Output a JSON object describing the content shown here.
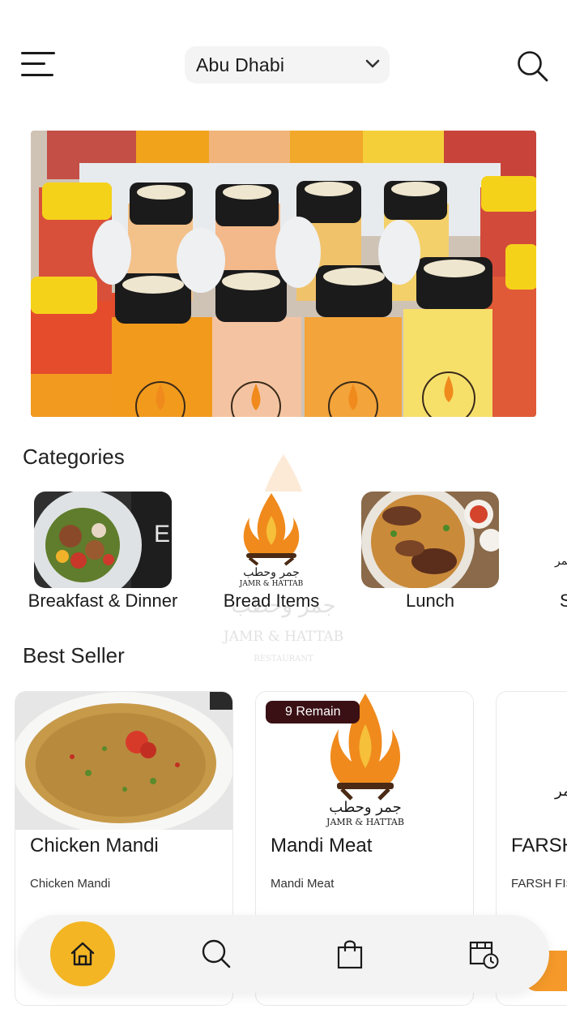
{
  "header": {
    "menu_icon": "hamburger-menu-icon",
    "location": "Abu Dhabi",
    "location_icon": "chevron-down-icon",
    "search_icon": "search-icon"
  },
  "banner": {
    "image": "bottled-juices-on-ice-photo"
  },
  "categories": {
    "title": "Categories",
    "items": [
      {
        "label": "Breakfast & Dinner",
        "image": "salad-plate-photo"
      },
      {
        "label": "Bread Items",
        "image": "jamr-hattab-logo"
      },
      {
        "label": "Lunch",
        "image": "rice-and-chicken-photo"
      },
      {
        "label": "S",
        "image": "jamr-hattab-logo"
      }
    ]
  },
  "best_seller": {
    "title": "Best Seller",
    "items": [
      {
        "name": "Chicken Mandi",
        "description": "Chicken Mandi",
        "image": "lentil-soup-photo"
      },
      {
        "name": "Mandi Meat",
        "description": "Mandi Meat",
        "badge": "9 Remain",
        "image": "jamr-hattab-logo"
      },
      {
        "name": "FARSH",
        "description": "FARSH FIS",
        "image": "jamr-hattab-logo"
      }
    ]
  },
  "watermark": {
    "arabic": "مطعم جمر وحطب",
    "english": "JAMR & HATTAB",
    "sub": "RESTAURANT"
  },
  "bottom_nav": {
    "items": [
      "home-icon",
      "search-icon",
      "shopping-bag-icon",
      "order-history-icon"
    ],
    "active": "home-icon",
    "active_color": "#f3b524"
  },
  "colors": {
    "accent": "#f3b524",
    "badge_bg": "#3a1015",
    "flame": "#f08a1c",
    "orange_tab": "#f59a2a"
  }
}
